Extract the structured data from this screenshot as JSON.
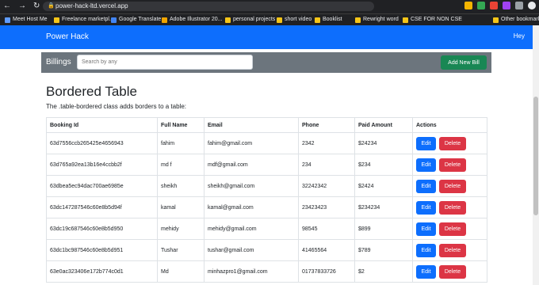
{
  "browser": {
    "url": "power-hack-ltd.vercel.app",
    "bookmarks": [
      {
        "label": "Meet Host Me",
        "color": "#5f9cff"
      },
      {
        "label": "Freelance marketpl...",
        "color": "#f5c518"
      },
      {
        "label": "Google Translate",
        "color": "#4285f4"
      },
      {
        "label": "Adobe Illustrator 20...",
        "color": "#f0a500"
      },
      {
        "label": "personal projects",
        "color": "#f5c518"
      },
      {
        "label": "short video",
        "color": "#f5c518"
      },
      {
        "label": "Booklist",
        "color": "#f5c518"
      },
      {
        "label": "Rewright word",
        "color": "#f5c518"
      },
      {
        "label": "CSE FOR NON CSE",
        "color": "#f5c518"
      },
      {
        "label": "Other bookmarks",
        "color": "#f5c518"
      }
    ]
  },
  "navbar": {
    "brand": "Power Hack",
    "user": "Hey"
  },
  "toolbar": {
    "title": "Billings",
    "search_placeholder": "Search by any",
    "add_label": "Add New Bill"
  },
  "main": {
    "heading": "Bordered Table",
    "description": "The .table-bordered class adds borders to a table:",
    "columns": [
      "Booking Id",
      "Full Name",
      "Email",
      "Phone",
      "Paid Amount",
      "Actions"
    ],
    "edit_label": "Edit",
    "delete_label": "Delete",
    "rows": [
      {
        "id": "63d7556ccb265425e4656943",
        "name": "fahim",
        "email": "fahim@gmail.com",
        "phone": "2342",
        "paid": "$24234"
      },
      {
        "id": "63d765a92ea13b16e4ccbb2f",
        "name": "md f",
        "email": "mdf@gmail.com",
        "phone": "234",
        "paid": "$234"
      },
      {
        "id": "63dbea5ec94dac700ae6985e",
        "name": "sheikh",
        "email": "sheikh@gmail.com",
        "phone": "32242342",
        "paid": "$2424"
      },
      {
        "id": "63dc147287546c60e8b5d94f",
        "name": "kamal",
        "email": "kamal@gmail.com",
        "phone": "23423423",
        "paid": "$234234"
      },
      {
        "id": "63dc19c687546c60e8b5d950",
        "name": "mehidy",
        "email": "mehidy@gmail.com",
        "phone": "98545",
        "paid": "$899"
      },
      {
        "id": "63dc1bc987546c60e8b5d951",
        "name": "Tushar",
        "email": "tushar@gmail.com",
        "phone": "41465564",
        "paid": "$789"
      },
      {
        "id": "63e0ac323406e172b774c0d1",
        "name": "Md",
        "email": "minhazpro1@gmail.com",
        "phone": "01737833726",
        "paid": "$2"
      }
    ]
  }
}
